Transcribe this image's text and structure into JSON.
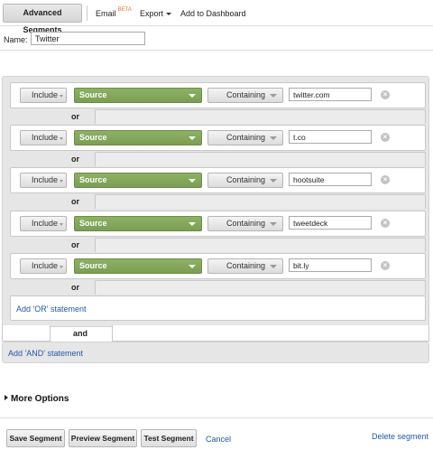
{
  "toolbar": {
    "advanced_segments": "Advanced Segments",
    "email": "Email",
    "email_badge": "BETA",
    "export": "Export",
    "add_dashboard": "Add to Dashboard"
  },
  "name": {
    "label": "Name:",
    "value": "Twitter"
  },
  "conditions": [
    {
      "include": "Include",
      "dimension": "Source",
      "match": "Containing",
      "value": "twitter.com"
    },
    {
      "include": "Include",
      "dimension": "Source",
      "match": "Containing",
      "value": "t.co"
    },
    {
      "include": "Include",
      "dimension": "Source",
      "match": "Containing",
      "value": "hootsuite"
    },
    {
      "include": "Include",
      "dimension": "Source",
      "match": "Containing",
      "value": "tweetdeck"
    },
    {
      "include": "Include",
      "dimension": "Source",
      "match": "Containing",
      "value": "bit.ly"
    }
  ],
  "or_label": "or",
  "add_or": "Add 'OR' statement",
  "and_label": "and",
  "add_and": "Add 'AND' statement",
  "more_options": "More Options",
  "footer": {
    "save": "Save Segment",
    "preview": "Preview Segment",
    "test": "Test Segment",
    "cancel": "Cancel",
    "delete": "Delete segment"
  },
  "colors": {
    "source_green": "#7fa356",
    "link_blue": "#2257a6",
    "beta_orange": "#e8732a"
  },
  "icons": {
    "remove": "remove-circle-icon",
    "dropdown": "dropdown-caret-icon",
    "expand": "expand-triangle-icon"
  }
}
